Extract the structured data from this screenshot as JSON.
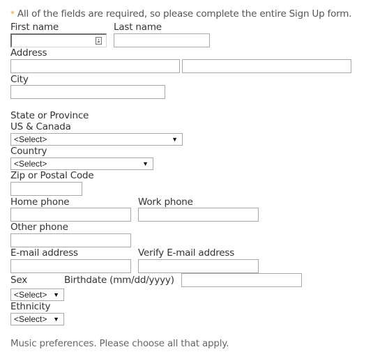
{
  "form": {
    "required_note": {
      "asterisk": "*",
      "text": "All of the fields are required, so please complete the entire Sign Up form."
    },
    "fields": {
      "first_name": {
        "label": "First name",
        "value": "",
        "icon": "contact-card-icon"
      },
      "last_name": {
        "label": "Last name",
        "value": ""
      },
      "address": {
        "label": "Address",
        "line1_value": "",
        "line2_value": ""
      },
      "city": {
        "label": "City",
        "value": ""
      },
      "state": {
        "label": "State or Province",
        "sublabel": "US & Canada",
        "selected": "<Select>"
      },
      "country": {
        "label": "Country",
        "selected": "<Select>"
      },
      "zip": {
        "label": "Zip or Postal Code",
        "value": ""
      },
      "home_phone": {
        "label": "Home phone",
        "value": ""
      },
      "work_phone": {
        "label": "Work phone",
        "value": ""
      },
      "other_phone": {
        "label": "Other phone",
        "value": ""
      },
      "email": {
        "label": "E-mail address",
        "value": ""
      },
      "verify_email": {
        "label": "Verify E-mail address",
        "value": ""
      },
      "sex": {
        "label": "Sex",
        "selected": "<Select>"
      },
      "birthdate": {
        "label": "Birthdate (mm/dd/yyyy)",
        "value": ""
      },
      "ethnicity": {
        "label": "Ethnicity",
        "selected": "<Select>"
      }
    },
    "music_note": "Music preferences. Please choose all that apply."
  },
  "colors": {
    "asterisk": "#e8a23c",
    "text": "#333333",
    "border": "#a8a8a8"
  }
}
